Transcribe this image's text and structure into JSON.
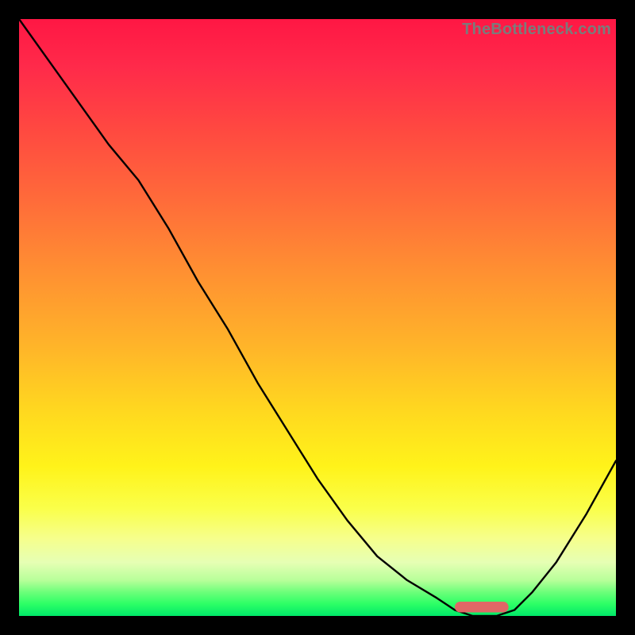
{
  "watermark": "TheBottleneck.com",
  "colors": {
    "frame": "#000000",
    "curve": "#000000",
    "marker": "#e06666",
    "gradient_top": "#ff1744",
    "gradient_bottom": "#00e868"
  },
  "chart_data": {
    "type": "line",
    "title": "",
    "xlabel": "",
    "ylabel": "",
    "xlim": [
      0,
      100
    ],
    "ylim": [
      0,
      100
    ],
    "grid": false,
    "legend": false,
    "notes": "No axis ticks or numeric labels are visible; values are estimated as percentage of plot area (0 = left/bottom, 100 = right/top). Curve is a bottleneck-style V: falls from top-left, flattens near bottom around x≈75–82, then rises to the right edge.",
    "series": [
      {
        "name": "bottleneck-curve",
        "x": [
          0,
          5,
          10,
          15,
          20,
          25,
          30,
          35,
          40,
          45,
          50,
          55,
          60,
          65,
          70,
          73,
          76,
          80,
          83,
          86,
          90,
          95,
          100
        ],
        "y": [
          100,
          93,
          86,
          79,
          73,
          65,
          56,
          48,
          39,
          31,
          23,
          16,
          10,
          6,
          3,
          1,
          0,
          0,
          1,
          4,
          9,
          17,
          26
        ]
      }
    ],
    "marker": {
      "name": "optimal-range",
      "shape": "rounded-bar",
      "x_start": 73,
      "x_end": 82,
      "y": 1.5,
      "color": "#e06666"
    }
  }
}
